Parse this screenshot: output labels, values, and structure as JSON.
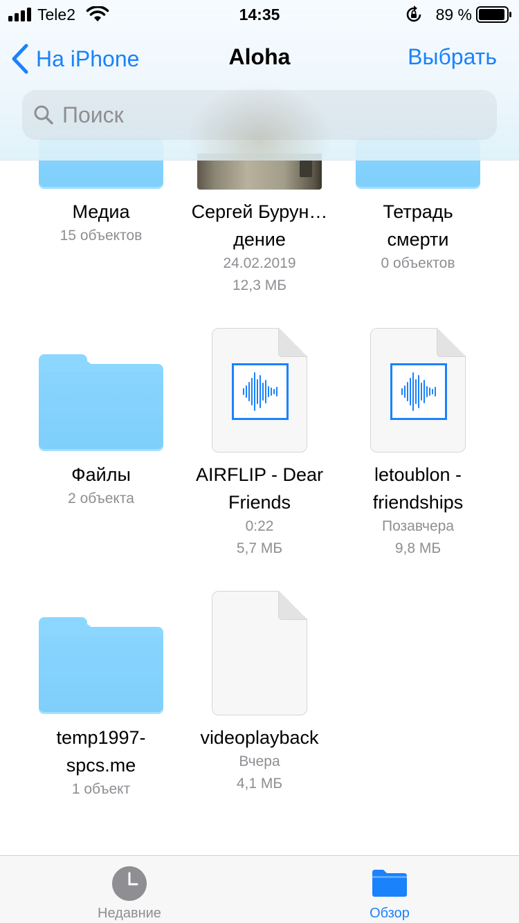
{
  "status_bar": {
    "carrier": "Tele2",
    "time": "14:35",
    "battery_percent": "89 %"
  },
  "nav": {
    "back_label": "На iPhone",
    "title": "Aloha",
    "select_label": "Выбрать"
  },
  "search": {
    "placeholder": "Поиск",
    "value": ""
  },
  "items": [
    {
      "kind": "folder",
      "name": "Медиа",
      "meta1": "15 объектов"
    },
    {
      "kind": "photo",
      "name": "Сергей Бурун…дение",
      "meta1": "24.02.2019",
      "meta2": "12,3 МБ"
    },
    {
      "kind": "folder",
      "name": "Тетрадь смерти",
      "meta1": "0 объектов"
    },
    {
      "kind": "folder",
      "name": "Файлы",
      "meta1": "2 объекта"
    },
    {
      "kind": "audio",
      "name": "AIRFLIP - Dear Friends",
      "meta1": "0:22",
      "meta2": "5,7 МБ"
    },
    {
      "kind": "audio",
      "name": "letoublon - friendships",
      "meta1": "Позавчера",
      "meta2": "9,8 МБ"
    },
    {
      "kind": "folder",
      "name": "temp1997-spcs.me",
      "meta1": "1 объект"
    },
    {
      "kind": "blank-doc",
      "name": "videoplayback",
      "meta1": "Вчера",
      "meta2": "4,1 МБ"
    }
  ],
  "tabbar": {
    "recents_label": "Недавние",
    "browse_label": "Обзор",
    "active_color": "#1a82fb",
    "inactive_color": "#8e8e93"
  },
  "colors": {
    "accent": "#1a82fb",
    "folder": "#8cd7ff",
    "secondary_text": "#8e8e93"
  }
}
